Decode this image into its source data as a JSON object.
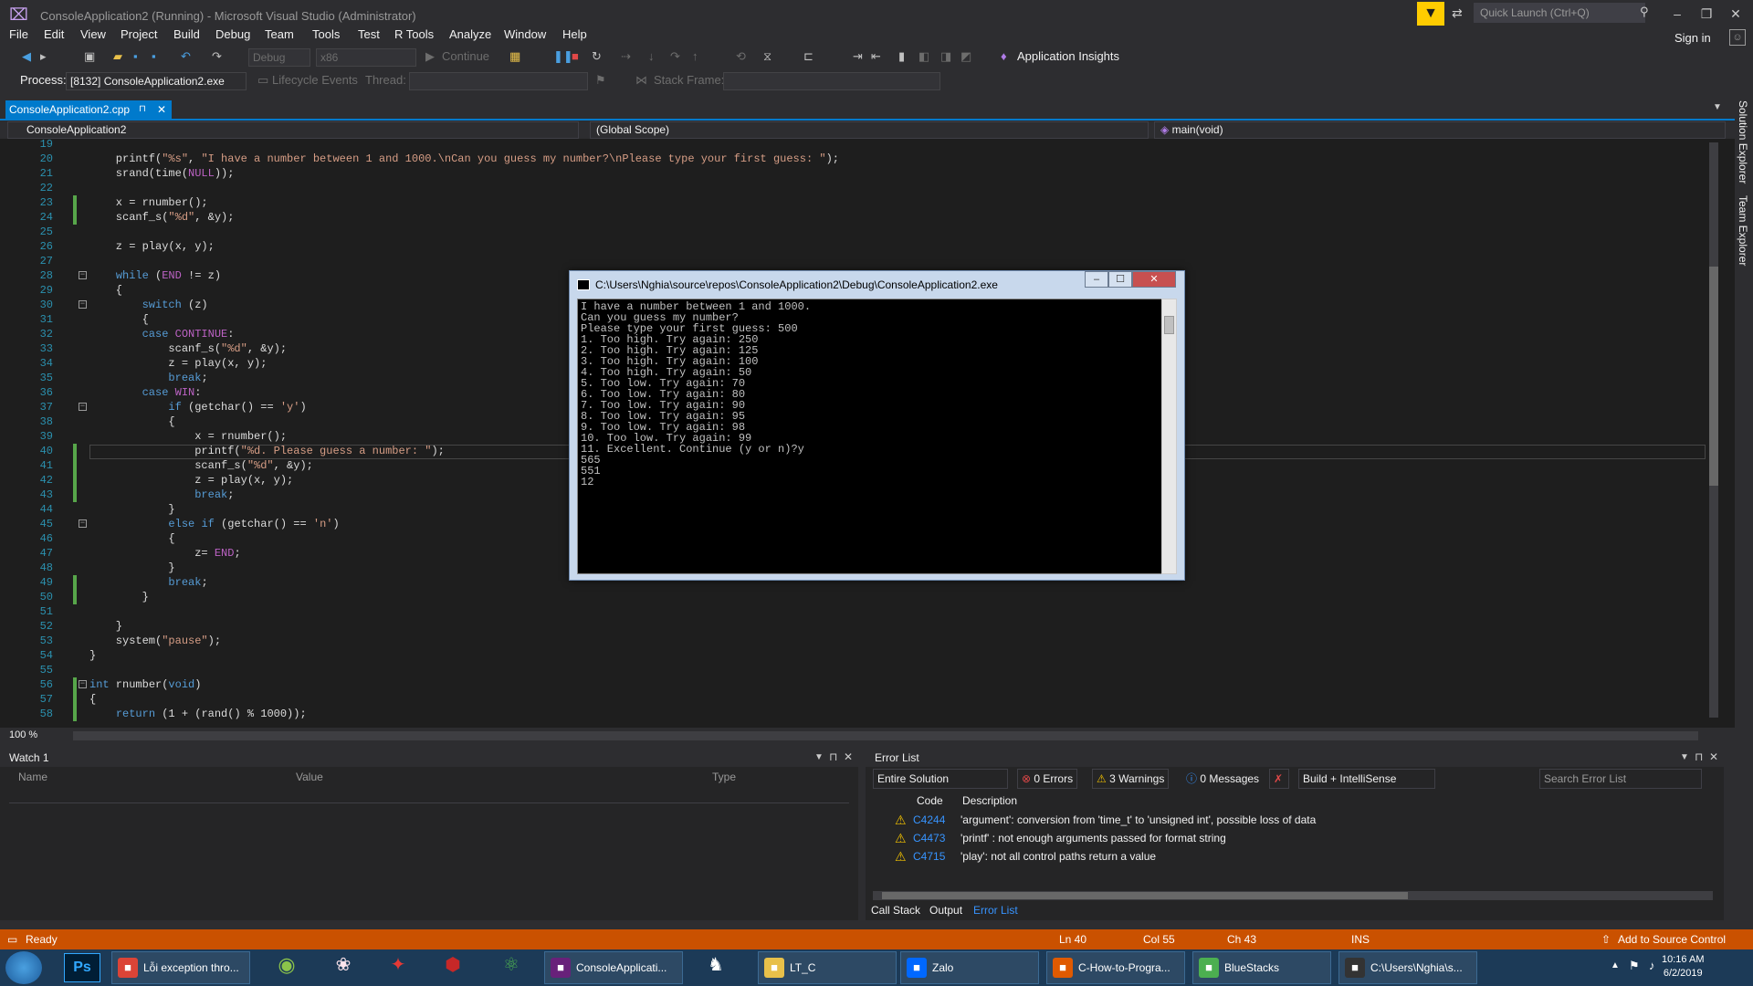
{
  "window": {
    "title": "ConsoleApplication2 (Running) - Microsoft Visual Studio  (Administrator)",
    "quick_launch_placeholder": "Quick Launch (Ctrl+Q)",
    "sign_in": "Sign in"
  },
  "menu": [
    "File",
    "Edit",
    "View",
    "Project",
    "Build",
    "Debug",
    "Team",
    "Tools",
    "Test",
    "R Tools",
    "Analyze",
    "Window",
    "Help"
  ],
  "toolbar": {
    "config": "Debug",
    "platform": "x86",
    "continue_label": "Continue",
    "app_insights": "Application Insights",
    "process_label": "Process:",
    "process_value": "[8132] ConsoleApplication2.exe",
    "lifecycle_label": "Lifecycle Events",
    "thread_label": "Thread:",
    "stack_frame_label": "Stack Frame:"
  },
  "doc_tab": "ConsoleApplication2.cpp",
  "navbar": {
    "project": "ConsoleApplication2",
    "scope": "(Global Scope)",
    "member": "main(void)"
  },
  "code_lines": [
    {
      "n": "19",
      "t": ""
    },
    {
      "n": "20",
      "t": "    printf(\"%s\", \"I have a number between 1 and 1000.\\nCan you guess my number?\\nPlease type your first guess: \");"
    },
    {
      "n": "21",
      "t": "    srand(time(NULL));"
    },
    {
      "n": "22",
      "t": ""
    },
    {
      "n": "23",
      "t": "    x = rnumber();"
    },
    {
      "n": "24",
      "t": "    scanf_s(\"%d\", &y);"
    },
    {
      "n": "25",
      "t": ""
    },
    {
      "n": "26",
      "t": "    z = play(x, y);"
    },
    {
      "n": "27",
      "t": ""
    },
    {
      "n": "28",
      "t": "    while (END != z)"
    },
    {
      "n": "29",
      "t": "    {"
    },
    {
      "n": "30",
      "t": "        switch (z)"
    },
    {
      "n": "31",
      "t": "        {"
    },
    {
      "n": "32",
      "t": "        case CONTINUE:"
    },
    {
      "n": "33",
      "t": "            scanf_s(\"%d\", &y);"
    },
    {
      "n": "34",
      "t": "            z = play(x, y);"
    },
    {
      "n": "35",
      "t": "            break;"
    },
    {
      "n": "36",
      "t": "        case WIN:"
    },
    {
      "n": "37",
      "t": "            if (getchar() == 'y')"
    },
    {
      "n": "38",
      "t": "            {"
    },
    {
      "n": "39",
      "t": "                x = rnumber();"
    },
    {
      "n": "40",
      "t": "                printf(\"%d. Please guess a number: \");"
    },
    {
      "n": "41",
      "t": "                scanf_s(\"%d\", &y);"
    },
    {
      "n": "42",
      "t": "                z = play(x, y);"
    },
    {
      "n": "43",
      "t": "                break;"
    },
    {
      "n": "44",
      "t": "            }"
    },
    {
      "n": "45",
      "t": "            else if (getchar() == 'n')"
    },
    {
      "n": "46",
      "t": "            {"
    },
    {
      "n": "47",
      "t": "                z= END;"
    },
    {
      "n": "48",
      "t": "            }"
    },
    {
      "n": "49",
      "t": "            break;"
    },
    {
      "n": "50",
      "t": "        }"
    },
    {
      "n": "51",
      "t": ""
    },
    {
      "n": "52",
      "t": "    }"
    },
    {
      "n": "53",
      "t": "    system(\"pause\");"
    },
    {
      "n": "54",
      "t": "}"
    },
    {
      "n": "55",
      "t": ""
    },
    {
      "n": "56",
      "t": "int rnumber(void)"
    },
    {
      "n": "57",
      "t": "{"
    },
    {
      "n": "58",
      "t": "    return (1 + (rand() % 1000));"
    }
  ],
  "zoom": "100 %",
  "console": {
    "title": "C:\\Users\\Nghia\\source\\repos\\ConsoleApplication2\\Debug\\ConsoleApplication2.exe",
    "lines": [
      "I have a number between 1 and 1000.",
      "Can you guess my number?",
      "Please type your first guess: 500",
      "1. Too high. Try again: 250",
      "2. Too high. Try again: 125",
      "3. Too high. Try again: 100",
      "4. Too high. Try again: 50",
      "5. Too low. Try again: 70",
      "6. Too low. Try again: 80",
      "7. Too low. Try again: 90",
      "8. Too low. Try again: 95",
      "9. Too low. Try again: 98",
      "10. Too low. Try again: 99",
      "11. Excellent. Continue (y or n)?y",
      "565",
      "551",
      "12"
    ]
  },
  "watch": {
    "title": "Watch 1",
    "cols": [
      "Name",
      "Value",
      "Type"
    ]
  },
  "error_list": {
    "title": "Error List",
    "scope": "Entire Solution",
    "errors": "0 Errors",
    "warnings": "3 Warnings",
    "messages": "0 Messages",
    "build": "Build + IntelliSense",
    "search_placeholder": "Search Error List",
    "col_code": "Code",
    "col_desc": "Description",
    "rows": [
      {
        "code": "C4244",
        "desc": "'argument': conversion from 'time_t' to 'unsigned int', possible loss of data"
      },
      {
        "code": "C4473",
        "desc": "'printf' : not enough arguments passed for format string"
      },
      {
        "code": "C4715",
        "desc": "'play': not all control paths return a value"
      }
    ]
  },
  "bottom_tabs": [
    "Call Stack",
    "Output",
    "Error List"
  ],
  "status": {
    "ready": "Ready",
    "ln": "Ln 40",
    "col": "Col 55",
    "ch": "Ch 43",
    "ins": "INS",
    "source_control": "Add to Source Control"
  },
  "side_tabs": [
    "Solution Explorer",
    "Team Explorer"
  ],
  "taskbar": {
    "items": [
      {
        "label": "Lỗi exception thro...",
        "icon": "chrome-icon",
        "color": "#db4437"
      },
      {
        "label": "ConsoleApplicati...",
        "icon": "visual-studio-icon",
        "color": "#68217a"
      },
      {
        "label": "LT_C",
        "icon": "folder-icon",
        "color": "#e8c04a"
      },
      {
        "label": "Zalo",
        "icon": "zalo-icon",
        "color": "#0068ff"
      },
      {
        "label": "C-How-to-Progra...",
        "icon": "pdf-reader-icon",
        "color": "#e05a00"
      },
      {
        "label": "BlueStacks",
        "icon": "bluestacks-icon",
        "color": "#4caf50"
      },
      {
        "label": "C:\\Users\\Nghia\\s...",
        "icon": "console-icon",
        "color": "#333333"
      }
    ],
    "time": "10:16 AM",
    "date": "6/2/2019"
  }
}
